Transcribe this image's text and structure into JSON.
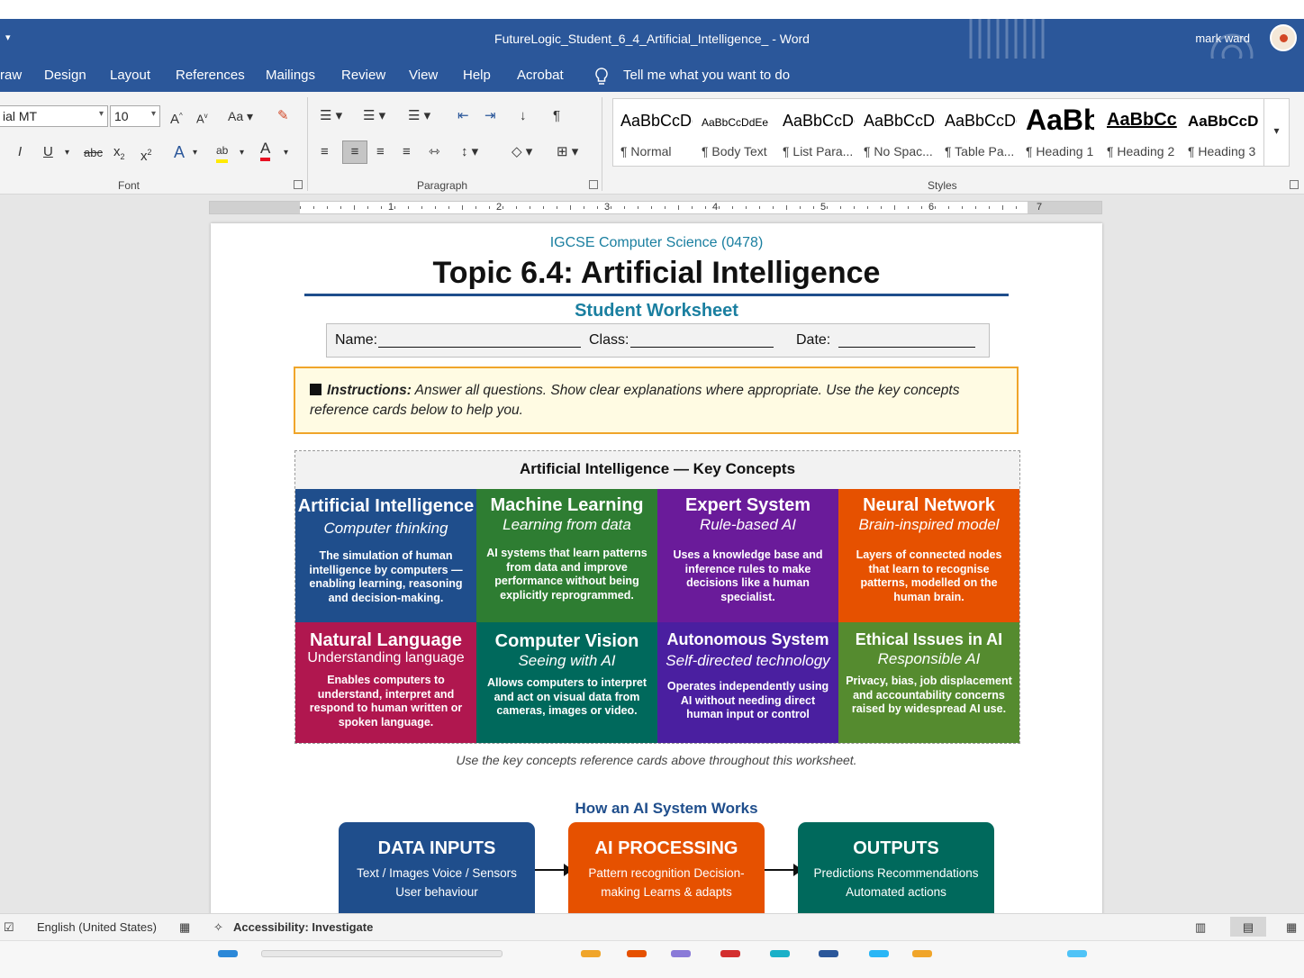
{
  "window": {
    "title": "FutureLogic_Student_6_4_Artificial_Intelligence_  -  Word",
    "user": "mark ward",
    "qat_icon": "customize-qat-icon"
  },
  "menu": {
    "tabs": [
      "raw",
      "Design",
      "Layout",
      "References",
      "Mailings",
      "Review",
      "View",
      "Help",
      "Acrobat"
    ],
    "tell_me": "Tell me what you want to do"
  },
  "ribbon": {
    "font_name": "ial MT",
    "font_size": "10",
    "font_group": "Font",
    "paragraph_group": "Paragraph",
    "styles_group": "Styles",
    "styles": [
      {
        "sample": "AaBbCcDc",
        "name": "¶ Normal"
      },
      {
        "sample": "AaBbCcDdEe",
        "name": "¶ Body Text"
      },
      {
        "sample": "AaBbCcDc",
        "name": "¶ List Para..."
      },
      {
        "sample": "AaBbCcDc",
        "name": "¶ No Spac..."
      },
      {
        "sample": "AaBbCcDc",
        "name": "¶ Table Pa..."
      },
      {
        "sample": "AaBb",
        "name": "¶ Heading 1"
      },
      {
        "sample": "AaBbCc",
        "name": "¶ Heading 2"
      },
      {
        "sample": "AaBbCcD",
        "name": "¶ Heading 3"
      }
    ]
  },
  "ruler": {
    "numbers": [
      "1",
      "2",
      "3",
      "4",
      "5",
      "6",
      "7"
    ]
  },
  "document": {
    "subject": "IGCSE Computer Science (0478)",
    "title": "Topic 6.4: Artificial Intelligence",
    "worksheet": "Student Worksheet",
    "name_label": "Name:",
    "class_label": "Class:",
    "date_label": "Date:",
    "instructions_label": "Instructions:",
    "instructions_text": " Answer all questions. Show clear explanations where appropriate. Use the key concepts reference cards below to help you.",
    "key_concepts_title": "Artificial Intelligence — Key Concepts",
    "cards": [
      {
        "title": "Artificial Intelligence",
        "subtitle": "Computer thinking",
        "desc": "The simulation of human intelligence by computers — enabling learning, reasoning and decision-making.",
        "color": "#1f4e8c"
      },
      {
        "title": "Machine Learning",
        "subtitle": "Learning from data",
        "desc": "AI systems that learn patterns from data and improve performance without being explicitly reprogrammed.",
        "color": "#2e7d32"
      },
      {
        "title": "Expert System",
        "subtitle": "Rule-based AI",
        "desc": "Uses a knowledge base and inference rules to make decisions like a human specialist.",
        "color": "#6a1b9a"
      },
      {
        "title": "Neural Network",
        "subtitle": "Brain-inspired model",
        "desc": "Layers of connected nodes that learn to recognise patterns, modelled on the human brain.",
        "color": "#e65100"
      },
      {
        "title": "Natural Language",
        "subtitle": "Understanding language",
        "desc": "Enables computers to understand, interpret and respond to human written or spoken language.",
        "color": "#b0174f"
      },
      {
        "title": "Computer Vision",
        "subtitle": "Seeing with AI",
        "desc": "Allows computers to interpret and act on visual data from cameras, images or video.",
        "color": "#00695c"
      },
      {
        "title": "Autonomous System",
        "subtitle": "Self-directed technology",
        "desc": "Operates independently using AI without needing direct human input or control",
        "color": "#4a1fa0"
      },
      {
        "title": "Ethical Issues in AI",
        "subtitle": "Responsible AI",
        "desc": "Privacy, bias, job displacement and accountability concerns raised by widespread AI use.",
        "color": "#558b2f"
      }
    ],
    "cards_caption": "Use the key concepts reference cards above throughout this worksheet.",
    "how_title": "How an AI System Works",
    "flow": [
      {
        "title": "DATA INPUTS",
        "desc": "Text / Images Voice / Sensors User behaviour",
        "color": "#1f4e8c"
      },
      {
        "title": "AI PROCESSING",
        "desc": "Pattern recognition Decision-making Learns & adapts",
        "color": "#e65100"
      },
      {
        "title": "OUTPUTS",
        "desc": "Predictions Recommendations Automated actions",
        "color": "#00695c"
      }
    ]
  },
  "status": {
    "language": "English (United States)",
    "accessibility": "Accessibility: Investigate"
  }
}
